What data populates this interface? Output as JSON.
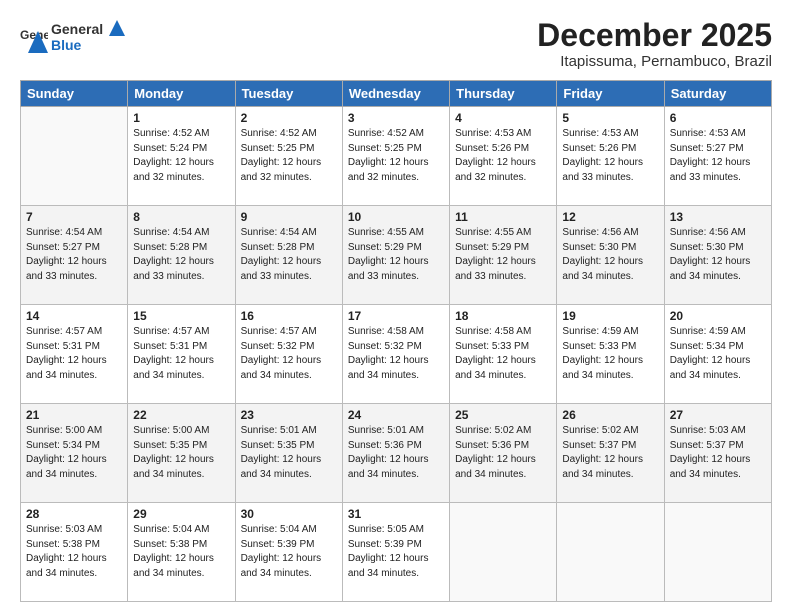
{
  "header": {
    "logo_general": "General",
    "logo_blue": "Blue",
    "title": "December 2025",
    "subtitle": "Itapissuma, Pernambuco, Brazil"
  },
  "days_of_week": [
    "Sunday",
    "Monday",
    "Tuesday",
    "Wednesday",
    "Thursday",
    "Friday",
    "Saturday"
  ],
  "weeks": [
    [
      {
        "day": "",
        "sunrise": "",
        "sunset": "",
        "daylight": ""
      },
      {
        "day": "1",
        "sunrise": "Sunrise: 4:52 AM",
        "sunset": "Sunset: 5:24 PM",
        "daylight": "Daylight: 12 hours and 32 minutes."
      },
      {
        "day": "2",
        "sunrise": "Sunrise: 4:52 AM",
        "sunset": "Sunset: 5:25 PM",
        "daylight": "Daylight: 12 hours and 32 minutes."
      },
      {
        "day": "3",
        "sunrise": "Sunrise: 4:52 AM",
        "sunset": "Sunset: 5:25 PM",
        "daylight": "Daylight: 12 hours and 32 minutes."
      },
      {
        "day": "4",
        "sunrise": "Sunrise: 4:53 AM",
        "sunset": "Sunset: 5:26 PM",
        "daylight": "Daylight: 12 hours and 32 minutes."
      },
      {
        "day": "5",
        "sunrise": "Sunrise: 4:53 AM",
        "sunset": "Sunset: 5:26 PM",
        "daylight": "Daylight: 12 hours and 33 minutes."
      },
      {
        "day": "6",
        "sunrise": "Sunrise: 4:53 AM",
        "sunset": "Sunset: 5:27 PM",
        "daylight": "Daylight: 12 hours and 33 minutes."
      }
    ],
    [
      {
        "day": "7",
        "sunrise": "Sunrise: 4:54 AM",
        "sunset": "Sunset: 5:27 PM",
        "daylight": "Daylight: 12 hours and 33 minutes."
      },
      {
        "day": "8",
        "sunrise": "Sunrise: 4:54 AM",
        "sunset": "Sunset: 5:28 PM",
        "daylight": "Daylight: 12 hours and 33 minutes."
      },
      {
        "day": "9",
        "sunrise": "Sunrise: 4:54 AM",
        "sunset": "Sunset: 5:28 PM",
        "daylight": "Daylight: 12 hours and 33 minutes."
      },
      {
        "day": "10",
        "sunrise": "Sunrise: 4:55 AM",
        "sunset": "Sunset: 5:29 PM",
        "daylight": "Daylight: 12 hours and 33 minutes."
      },
      {
        "day": "11",
        "sunrise": "Sunrise: 4:55 AM",
        "sunset": "Sunset: 5:29 PM",
        "daylight": "Daylight: 12 hours and 33 minutes."
      },
      {
        "day": "12",
        "sunrise": "Sunrise: 4:56 AM",
        "sunset": "Sunset: 5:30 PM",
        "daylight": "Daylight: 12 hours and 34 minutes."
      },
      {
        "day": "13",
        "sunrise": "Sunrise: 4:56 AM",
        "sunset": "Sunset: 5:30 PM",
        "daylight": "Daylight: 12 hours and 34 minutes."
      }
    ],
    [
      {
        "day": "14",
        "sunrise": "Sunrise: 4:57 AM",
        "sunset": "Sunset: 5:31 PM",
        "daylight": "Daylight: 12 hours and 34 minutes."
      },
      {
        "day": "15",
        "sunrise": "Sunrise: 4:57 AM",
        "sunset": "Sunset: 5:31 PM",
        "daylight": "Daylight: 12 hours and 34 minutes."
      },
      {
        "day": "16",
        "sunrise": "Sunrise: 4:57 AM",
        "sunset": "Sunset: 5:32 PM",
        "daylight": "Daylight: 12 hours and 34 minutes."
      },
      {
        "day": "17",
        "sunrise": "Sunrise: 4:58 AM",
        "sunset": "Sunset: 5:32 PM",
        "daylight": "Daylight: 12 hours and 34 minutes."
      },
      {
        "day": "18",
        "sunrise": "Sunrise: 4:58 AM",
        "sunset": "Sunset: 5:33 PM",
        "daylight": "Daylight: 12 hours and 34 minutes."
      },
      {
        "day": "19",
        "sunrise": "Sunrise: 4:59 AM",
        "sunset": "Sunset: 5:33 PM",
        "daylight": "Daylight: 12 hours and 34 minutes."
      },
      {
        "day": "20",
        "sunrise": "Sunrise: 4:59 AM",
        "sunset": "Sunset: 5:34 PM",
        "daylight": "Daylight: 12 hours and 34 minutes."
      }
    ],
    [
      {
        "day": "21",
        "sunrise": "Sunrise: 5:00 AM",
        "sunset": "Sunset: 5:34 PM",
        "daylight": "Daylight: 12 hours and 34 minutes."
      },
      {
        "day": "22",
        "sunrise": "Sunrise: 5:00 AM",
        "sunset": "Sunset: 5:35 PM",
        "daylight": "Daylight: 12 hours and 34 minutes."
      },
      {
        "day": "23",
        "sunrise": "Sunrise: 5:01 AM",
        "sunset": "Sunset: 5:35 PM",
        "daylight": "Daylight: 12 hours and 34 minutes."
      },
      {
        "day": "24",
        "sunrise": "Sunrise: 5:01 AM",
        "sunset": "Sunset: 5:36 PM",
        "daylight": "Daylight: 12 hours and 34 minutes."
      },
      {
        "day": "25",
        "sunrise": "Sunrise: 5:02 AM",
        "sunset": "Sunset: 5:36 PM",
        "daylight": "Daylight: 12 hours and 34 minutes."
      },
      {
        "day": "26",
        "sunrise": "Sunrise: 5:02 AM",
        "sunset": "Sunset: 5:37 PM",
        "daylight": "Daylight: 12 hours and 34 minutes."
      },
      {
        "day": "27",
        "sunrise": "Sunrise: 5:03 AM",
        "sunset": "Sunset: 5:37 PM",
        "daylight": "Daylight: 12 hours and 34 minutes."
      }
    ],
    [
      {
        "day": "28",
        "sunrise": "Sunrise: 5:03 AM",
        "sunset": "Sunset: 5:38 PM",
        "daylight": "Daylight: 12 hours and 34 minutes."
      },
      {
        "day": "29",
        "sunrise": "Sunrise: 5:04 AM",
        "sunset": "Sunset: 5:38 PM",
        "daylight": "Daylight: 12 hours and 34 minutes."
      },
      {
        "day": "30",
        "sunrise": "Sunrise: 5:04 AM",
        "sunset": "Sunset: 5:39 PM",
        "daylight": "Daylight: 12 hours and 34 minutes."
      },
      {
        "day": "31",
        "sunrise": "Sunrise: 5:05 AM",
        "sunset": "Sunset: 5:39 PM",
        "daylight": "Daylight: 12 hours and 34 minutes."
      },
      {
        "day": "",
        "sunrise": "",
        "sunset": "",
        "daylight": ""
      },
      {
        "day": "",
        "sunrise": "",
        "sunset": "",
        "daylight": ""
      },
      {
        "day": "",
        "sunrise": "",
        "sunset": "",
        "daylight": ""
      }
    ]
  ]
}
